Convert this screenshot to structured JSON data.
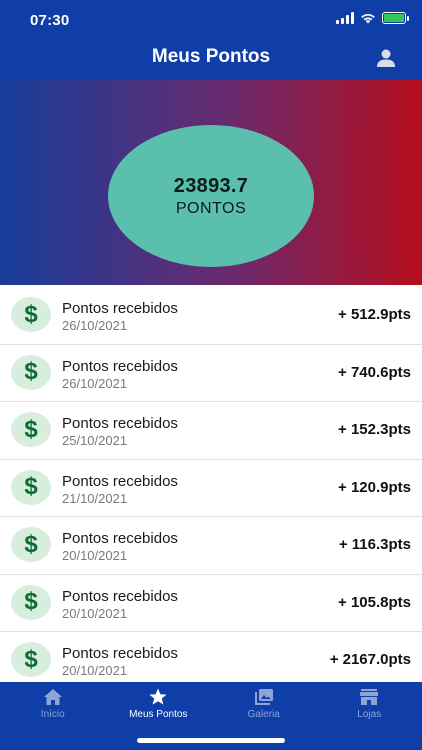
{
  "status": {
    "time": "07:30"
  },
  "nav": {
    "title": "Meus Pontos"
  },
  "points": {
    "value": "23893.7",
    "label": "PONTOS"
  },
  "transactions": [
    {
      "title": "Pontos recebidos",
      "date": "26/10/2021",
      "amount": "+ 512.9pts"
    },
    {
      "title": "Pontos recebidos",
      "date": "26/10/2021",
      "amount": "+ 740.6pts"
    },
    {
      "title": "Pontos recebidos",
      "date": "25/10/2021",
      "amount": "+ 152.3pts"
    },
    {
      "title": "Pontos recebidos",
      "date": "21/10/2021",
      "amount": "+ 120.9pts"
    },
    {
      "title": "Pontos recebidos",
      "date": "20/10/2021",
      "amount": "+ 116.3pts"
    },
    {
      "title": "Pontos recebidos",
      "date": "20/10/2021",
      "amount": "+ 105.8pts"
    },
    {
      "title": "Pontos recebidos",
      "date": "20/10/2021",
      "amount": "+ 2167.0pts"
    }
  ],
  "dollar_symbol": "$",
  "tabs": [
    {
      "label": "Início",
      "icon": "home-icon",
      "active": false
    },
    {
      "label": "Meus Pontos",
      "icon": "star-icon",
      "active": true
    },
    {
      "label": "Galeria",
      "icon": "gallery-icon",
      "active": false
    },
    {
      "label": "Lojas",
      "icon": "store-icon",
      "active": false
    }
  ],
  "colors": {
    "primary": "#0f3ea8",
    "gradient_start": "#163d99",
    "gradient_end": "#b50d1c",
    "circle": "#5bbfae",
    "dollar_bg": "#d8eedc",
    "dollar_fg": "#0e6b34"
  }
}
